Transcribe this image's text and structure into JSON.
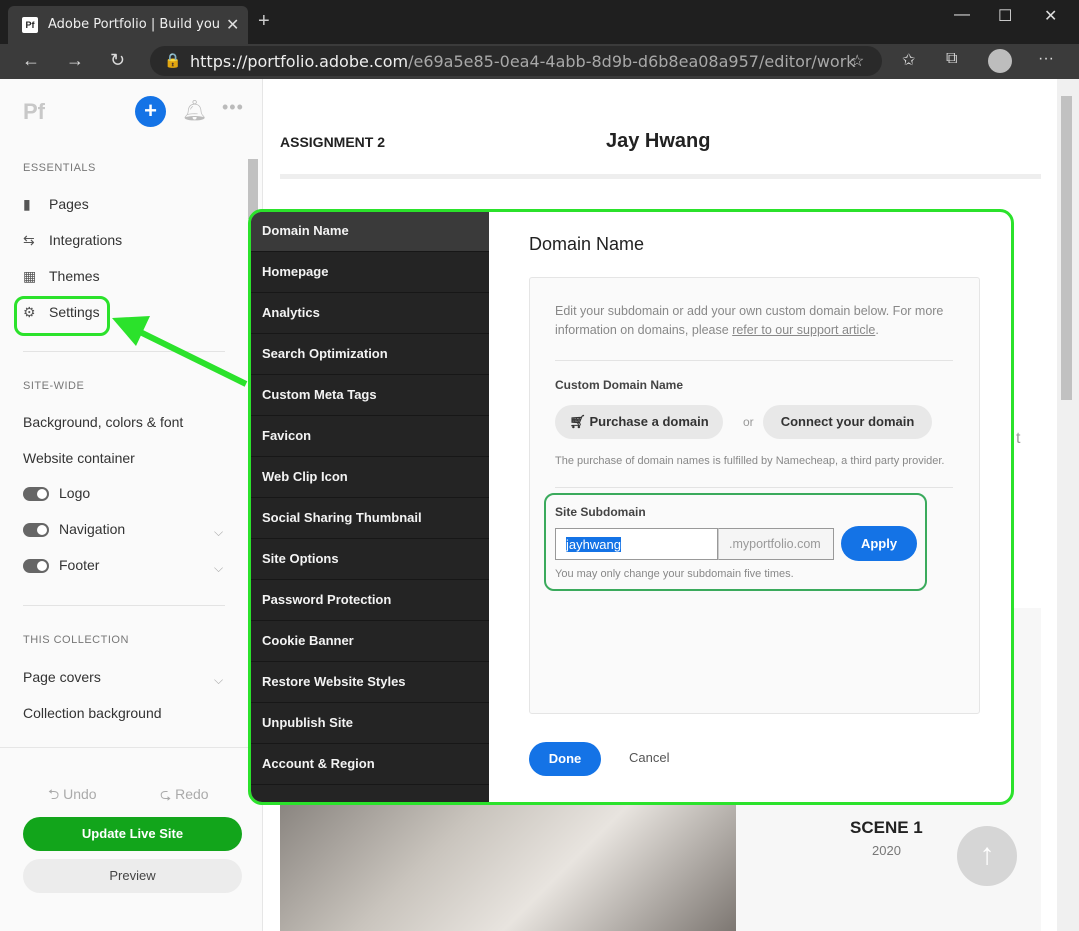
{
  "browser": {
    "tab_title": "Adobe Portfolio | Build your own",
    "favicon_text": "Pf",
    "url_proto": "https://",
    "url_host": "portfolio.adobe.com",
    "url_path": "/e69a5e85-0ea4-4abb-8d9b-d6b8ea08a957/editor/work"
  },
  "sidebar": {
    "logo": "Pf",
    "essentials_heading": "ESSENTIALS",
    "essentials": [
      {
        "label": "Pages"
      },
      {
        "label": "Integrations"
      },
      {
        "label": "Themes"
      },
      {
        "label": "Settings"
      }
    ],
    "sitewide_heading": "SITE-WIDE",
    "sitewide": [
      {
        "label": "Background, colors & font"
      },
      {
        "label": "Website container"
      },
      {
        "label": "Logo"
      },
      {
        "label": "Navigation"
      },
      {
        "label": "Footer"
      }
    ],
    "collection_heading": "THIS COLLECTION",
    "collection": [
      {
        "label": "Page covers"
      },
      {
        "label": "Collection background"
      }
    ],
    "undo": "Undo",
    "redo": "Redo",
    "update_label": "Update Live Site",
    "preview_label": "Preview"
  },
  "page": {
    "title": "ASSIGNMENT 2",
    "name": "Jay Hwang",
    "scene": "SCENE 1",
    "year": "2020",
    "peek_char": "t"
  },
  "modal": {
    "nav": [
      "Domain Name",
      "Homepage",
      "Analytics",
      "Search Optimization",
      "Custom Meta Tags",
      "Favicon",
      "Web Clip Icon",
      "Social Sharing Thumbnail",
      "Site Options",
      "Password Protection",
      "Cookie Banner",
      "Restore Website Styles",
      "Unpublish Site",
      "Account & Region"
    ],
    "title": "Domain Name",
    "desc_text": "Edit your subdomain or add your own custom domain below. For more information on domains, please ",
    "desc_link": "refer to our support article",
    "custom_label": "Custom Domain Name",
    "purchase_label": "Purchase a domain",
    "or": "or",
    "connect_label": "Connect your domain",
    "namecheap_note": "The purchase of domain names is fulfilled by Namecheap, a third party provider.",
    "subdomain_label": "Site Subdomain",
    "subdomain_value": "jayhwang",
    "subdomain_suffix": ".myportfolio.com",
    "apply_label": "Apply",
    "subdomain_note": "You may only change your subdomain five times.",
    "done_label": "Done",
    "cancel_label": "Cancel"
  },
  "colors": {
    "accent_blue": "#1473e6",
    "update_green": "#12a51b",
    "annotation_green": "#2be22b"
  }
}
